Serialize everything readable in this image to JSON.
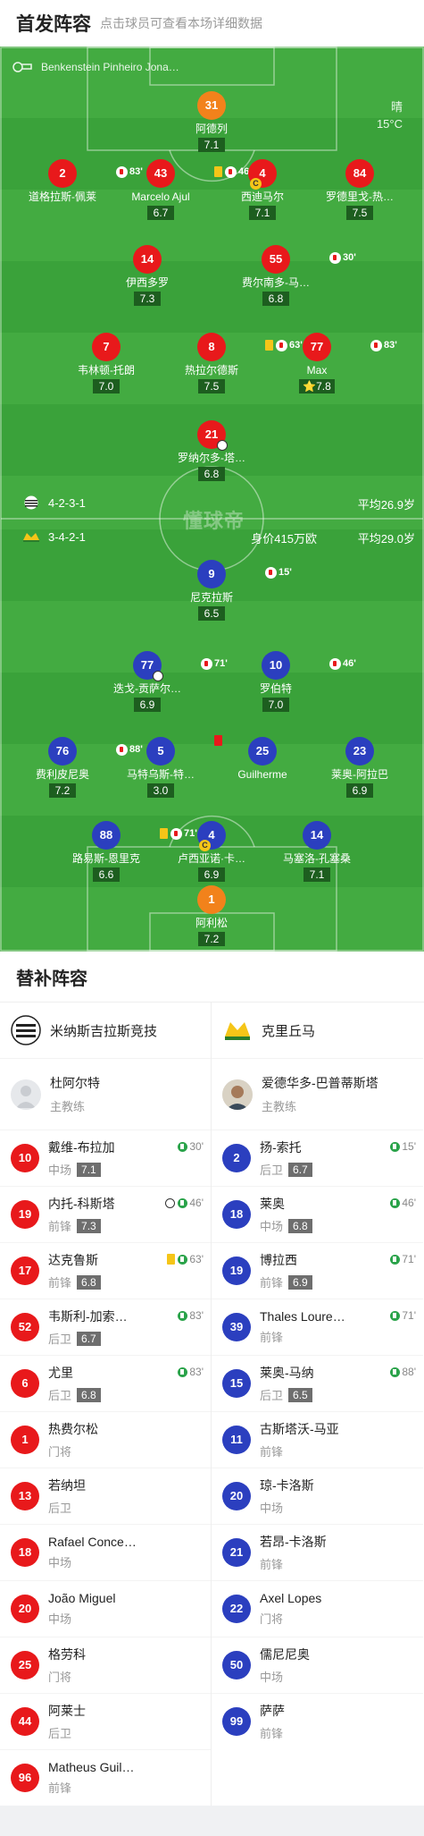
{
  "header": {
    "title": "首发阵容",
    "subtitle": "点击球员可查看本场详细数据"
  },
  "referee": "Benkenstein Pinheiro Jona…",
  "weather": {
    "condition": "晴",
    "temp": "15°C"
  },
  "home": {
    "formation": "4-2-3-1",
    "avg_age": "平均26.9岁",
    "players": [
      {
        "num": "31",
        "name": "阿德列",
        "rating": "7.1"
      },
      {
        "num": "2",
        "name": "道格拉斯-佩莱",
        "rating": "",
        "sub": "83'"
      },
      {
        "num": "43",
        "name": "Marcelo Ajul",
        "rating": "6.7",
        "sub": "46'"
      },
      {
        "num": "4",
        "name": "西迪马尔",
        "rating": "7.1"
      },
      {
        "num": "84",
        "name": "罗德里戈-热…",
        "rating": "7.5"
      },
      {
        "num": "14",
        "name": "伊西多罗",
        "rating": "7.3"
      },
      {
        "num": "55",
        "name": "费尔南多-马…",
        "rating": "6.8",
        "sub": "30'"
      },
      {
        "num": "7",
        "name": "韦林顿-托朗",
        "rating": "7.0"
      },
      {
        "num": "8",
        "name": "热拉尔德斯",
        "rating": "7.5",
        "sub": "63'"
      },
      {
        "num": "77",
        "name": "Max",
        "rating": "7.8",
        "sub": "83'"
      },
      {
        "num": "21",
        "name": "罗纳尔多-塔…",
        "rating": "6.8"
      }
    ]
  },
  "away": {
    "formation": "3-4-2-1",
    "value": "身价415万欧",
    "avg_age": "平均29.0岁",
    "players": [
      {
        "num": "9",
        "name": "尼克拉斯",
        "rating": "6.5",
        "sub": "15'"
      },
      {
        "num": "77",
        "name": "迭戈-贡萨尔…",
        "rating": "6.9",
        "sub": "71'"
      },
      {
        "num": "10",
        "name": "罗伯特",
        "rating": "7.0",
        "sub": "46'"
      },
      {
        "num": "76",
        "name": "费利皮尼奥",
        "rating": "7.2",
        "sub": "88'"
      },
      {
        "num": "5",
        "name": "马特乌斯-特…",
        "rating": "3.0"
      },
      {
        "num": "25",
        "name": "Guilherme",
        "rating": ""
      },
      {
        "num": "23",
        "name": "莱奥-阿拉巴",
        "rating": "6.9"
      },
      {
        "num": "88",
        "name": "路易斯-恩里克",
        "rating": "6.6",
        "sub": "71'"
      },
      {
        "num": "4",
        "name": "卢西亚诺·卡…",
        "rating": "6.9"
      },
      {
        "num": "14",
        "name": "马塞洛-孔塞桑",
        "rating": "7.1"
      },
      {
        "num": "1",
        "name": "阿利松",
        "rating": "7.2"
      }
    ]
  },
  "pitch_logo": "懂球帝",
  "bench": {
    "title": "替补阵容",
    "home_team": "米纳斯吉拉斯竞技",
    "away_team": "克里丘马",
    "home_coach": {
      "name": "杜阿尔特",
      "role": "主教练"
    },
    "away_coach": {
      "name": "爱德华多-巴普蒂斯塔",
      "role": "主教练"
    },
    "home": [
      {
        "num": "10",
        "name": "戴维-布拉加",
        "pos": "中场",
        "rating": "7.1",
        "ev": "30'"
      },
      {
        "num": "19",
        "name": "内托-科斯塔",
        "pos": "前锋",
        "rating": "7.3",
        "ev": "46'"
      },
      {
        "num": "17",
        "name": "达克鲁斯",
        "pos": "前锋",
        "rating": "6.8",
        "ev": "63'"
      },
      {
        "num": "52",
        "name": "韦斯利-加索…",
        "pos": "后卫",
        "rating": "6.7",
        "ev": "83'"
      },
      {
        "num": "6",
        "name": "尤里",
        "pos": "后卫",
        "rating": "6.8",
        "ev": "83'"
      },
      {
        "num": "1",
        "name": "热费尔松",
        "pos": "门将",
        "rating": "",
        "ev": ""
      },
      {
        "num": "13",
        "name": "若纳坦",
        "pos": "后卫",
        "rating": "",
        "ev": ""
      },
      {
        "num": "18",
        "name": "Rafael Conce…",
        "pos": "中场",
        "rating": "",
        "ev": ""
      },
      {
        "num": "20",
        "name": "João Miguel",
        "pos": "中场",
        "rating": "",
        "ev": ""
      },
      {
        "num": "25",
        "name": "格劳科",
        "pos": "门将",
        "rating": "",
        "ev": ""
      },
      {
        "num": "44",
        "name": "阿莱士",
        "pos": "后卫",
        "rating": "",
        "ev": ""
      },
      {
        "num": "96",
        "name": "Matheus Guil…",
        "pos": "前锋",
        "rating": "",
        "ev": ""
      }
    ],
    "away": [
      {
        "num": "2",
        "name": "扬-索托",
        "pos": "后卫",
        "rating": "6.7",
        "ev": "15'"
      },
      {
        "num": "18",
        "name": "莱奥",
        "pos": "中场",
        "rating": "6.8",
        "ev": "46'"
      },
      {
        "num": "19",
        "name": "博拉西",
        "pos": "前锋",
        "rating": "6.9",
        "ev": "71'"
      },
      {
        "num": "39",
        "name": "Thales Loure…",
        "pos": "前锋",
        "rating": "",
        "ev": "71'"
      },
      {
        "num": "15",
        "name": "莱奥-马纳",
        "pos": "后卫",
        "rating": "6.5",
        "ev": "88'"
      },
      {
        "num": "11",
        "name": "古斯塔沃-马亚",
        "pos": "前锋",
        "rating": "",
        "ev": ""
      },
      {
        "num": "20",
        "name": "琼-卡洛斯",
        "pos": "中场",
        "rating": "",
        "ev": ""
      },
      {
        "num": "21",
        "name": "若昂-卡洛斯",
        "pos": "前锋",
        "rating": "",
        "ev": ""
      },
      {
        "num": "22",
        "name": "Axel Lopes",
        "pos": "门将",
        "rating": "",
        "ev": ""
      },
      {
        "num": "50",
        "name": "儒尼尼奥",
        "pos": "中场",
        "rating": "",
        "ev": ""
      },
      {
        "num": "99",
        "name": "萨萨",
        "pos": "前锋",
        "rating": "",
        "ev": ""
      }
    ]
  }
}
